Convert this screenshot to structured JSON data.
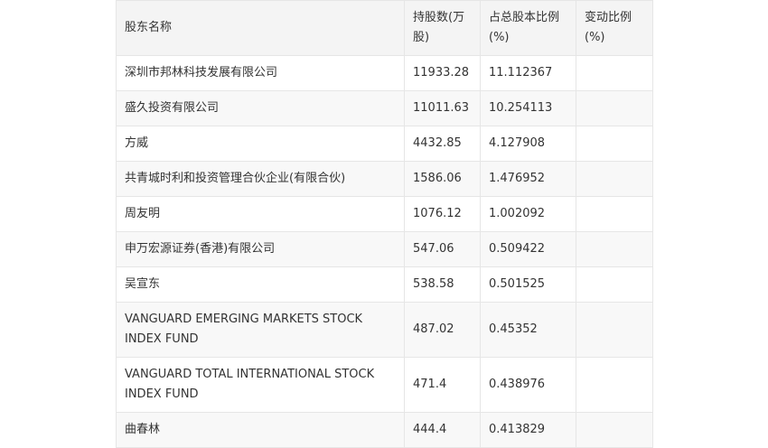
{
  "header": {
    "name": "股东名称",
    "shares": "持股数(万股)",
    "ratio": "占总股本比例(%)",
    "change": "变动比例(%)"
  },
  "rows": [
    {
      "name": "深圳市邦林科技发展有限公司",
      "shares": "11933.28",
      "ratio": "11.112367",
      "change": ""
    },
    {
      "name": "盛久投资有限公司",
      "shares": "11011.63",
      "ratio": "10.254113",
      "change": ""
    },
    {
      "name": "方威",
      "shares": "4432.85",
      "ratio": "4.127908",
      "change": ""
    },
    {
      "name": "共青城时利和投资管理合伙企业(有限合伙)",
      "shares": "1586.06",
      "ratio": "1.476952",
      "change": ""
    },
    {
      "name": "周友明",
      "shares": "1076.12",
      "ratio": "1.002092",
      "change": ""
    },
    {
      "name": "申万宏源证券(香港)有限公司",
      "shares": "547.06",
      "ratio": "0.509422",
      "change": ""
    },
    {
      "name": "吴宣东",
      "shares": "538.58",
      "ratio": "0.501525",
      "change": ""
    },
    {
      "name": "VANGUARD EMERGING MARKETS STOCK INDEX FUND",
      "shares": "487.02",
      "ratio": "0.45352",
      "change": ""
    },
    {
      "name": "VANGUARD TOTAL INTERNATIONAL STOCK INDEX FUND",
      "shares": "471.4",
      "ratio": "0.438976",
      "change": ""
    },
    {
      "name": "曲春林",
      "shares": "444.4",
      "ratio": "0.413829",
      "change": ""
    }
  ]
}
